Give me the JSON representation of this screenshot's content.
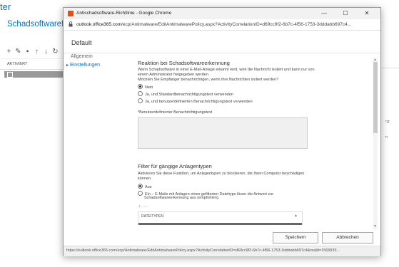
{
  "background": {
    "title": "ter",
    "section": "Schadsoftwarefilter",
    "toolbar_icons": [
      "add-icon",
      "edit-icon",
      "delete-icon",
      "up-icon",
      "down-icon",
      "refresh-icon"
    ],
    "toolbar_glyphs": [
      "+",
      "✎",
      "▪",
      "↑",
      "↓",
      "↻"
    ],
    "column_header": "AKTIVIERT",
    "right_text_1": "rg:",
    "right_text_2": "n"
  },
  "window": {
    "title": "Antischadsoftware-Richtlinie - Google Chrome",
    "controls": [
      "—",
      "☐",
      "✕"
    ],
    "url_host": "outlook.office365.com",
    "url_path": "/ecp/Antimalware/EditAntimalwarePolicy.aspx?ActivityCorrelationID=d69cc9f2-6b7c-4f56-1753-3dddabb697c4..."
  },
  "dialog": {
    "heading": "Default",
    "nav": [
      "Allgemein",
      "Einstellungen"
    ],
    "section1": {
      "title": "Reaktion bei Schadsoftwareerkennung",
      "text1": "Wenn Schadsoftware in einer E-Mail-Anlage erkannt wird, wird die Nachricht isoliert und kann nur von einem Administrator freigegeben werden.",
      "text2": "Möchten Sie Empfänger benachrichtigen, wenn ihre Nachrichten isoliert werden?",
      "options": [
        {
          "label": "Nein",
          "checked": true
        },
        {
          "label": "Ja, und Standardbenachrichtigungstext verwenden",
          "checked": false
        },
        {
          "label": "Ja, und benutzerdefinierten Benachrichtigungstext verwenden",
          "checked": false
        }
      ]
    },
    "custom_text_label": "*Benutzerdefinierter Benachrichtigungstext",
    "section2": {
      "title": "Filter für gängige Anlagentypen",
      "text": "Aktivieren Sie diese Funktion, um Anlagentypen zu blockieren, die Ihren Computer beschädigen können.",
      "options": [
        {
          "label": "Aus",
          "checked": true
        },
        {
          "label": "Ein – E-Mails mit Anlagen eines gefilterten Dateityps lösen die Antwort zur",
          "checked": false
        }
      ],
      "option_continuation": "Schadsoftwareerkennung aus (empfohlen)."
    },
    "add_glyph": "+",
    "remove_glyph": "—",
    "table_header": "DATEITYPEN",
    "sort_glyph": "▲",
    "save_button": "Speichern",
    "cancel_button": "Abbrechen"
  },
  "statusbar": "https://outlook.office365.com/ecp/Antimalware/EditAntimalwarePolicy.aspx?ActivityCorrelationID=d69cc9f2-6b7c-4f56-1753-3dddabb697c4&reqId=1569933..."
}
